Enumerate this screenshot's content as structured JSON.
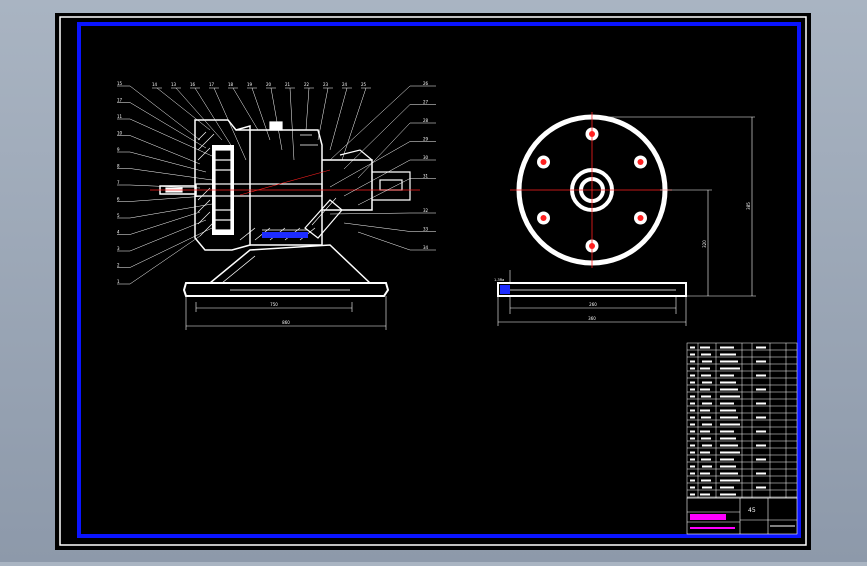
{
  "colors": {
    "desktop": "#9aa6b6",
    "paper": "#000000",
    "outer_border": "#ffffff",
    "inner_border": "#0a14ff",
    "part": "#ffffff",
    "center_line": "#ff2020",
    "leader": "#ffffff",
    "hatch": "#ffffff",
    "title_magenta": "#ff00ff",
    "base_blue": "#1d2cff"
  },
  "side_view": {
    "callouts_left": [
      "15",
      "17",
      "11",
      "10",
      "9",
      "8",
      "7",
      "6",
      "5",
      "4",
      "3",
      "2",
      "1"
    ],
    "callouts_top": [
      "14",
      "13",
      "16",
      "17",
      "18",
      "19",
      "20",
      "21",
      "22",
      "23",
      "24",
      "25"
    ],
    "callouts_right": [
      "26",
      "27",
      "28",
      "29",
      "30",
      "31",
      "32",
      "33",
      "34"
    ],
    "dim_inner": "750",
    "dim_outer": "860"
  },
  "front_view": {
    "dim_height_outer": "385",
    "dim_height_inner": "320",
    "dim_base_inner": "260",
    "dim_base_outer": "360",
    "base_label": "1-3Ra"
  },
  "title_block": {
    "drawing_no": "45"
  }
}
